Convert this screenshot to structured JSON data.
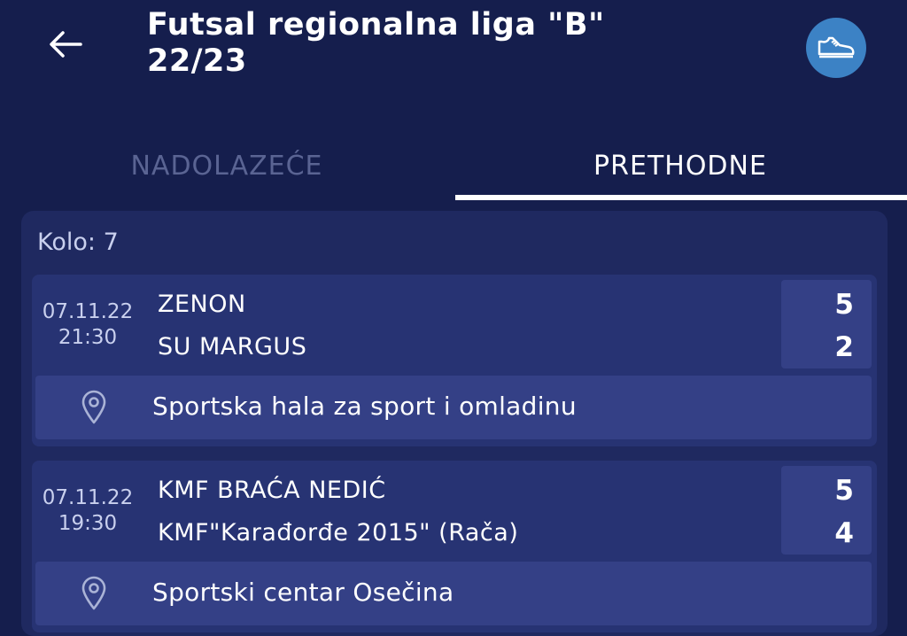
{
  "header": {
    "title_line1": "Futsal regionalna liga \"B\"",
    "title_line2": "22/23",
    "back_icon": "arrow-left-icon",
    "action_icon": "sneaker-icon"
  },
  "tabs": [
    {
      "label": "NADOLAZEĆE",
      "active": false
    },
    {
      "label": "PRETHODNE",
      "active": true
    }
  ],
  "round": {
    "label": "Kolo: 7",
    "matches": [
      {
        "date": "07.11.22",
        "time": "21:30",
        "home": "ZENON",
        "away": "SU MARGUS",
        "home_score": "5",
        "away_score": "2",
        "venue": "Sportska hala za sport i omladinu"
      },
      {
        "date": "07.11.22",
        "time": "19:30",
        "home": "KMF BRAĆA NEDIĆ",
        "away": "KMF\"Karađorđe 2015\" (Rača)",
        "home_score": "5",
        "away_score": "4",
        "venue": "Sportski centar Osečina"
      }
    ]
  },
  "colors": {
    "background": "#151e4d",
    "card": "#1f2960",
    "match": "#273373",
    "accent_box": "#344086",
    "action_button": "#3c82c5",
    "inactive_tab": "#5a6493"
  }
}
